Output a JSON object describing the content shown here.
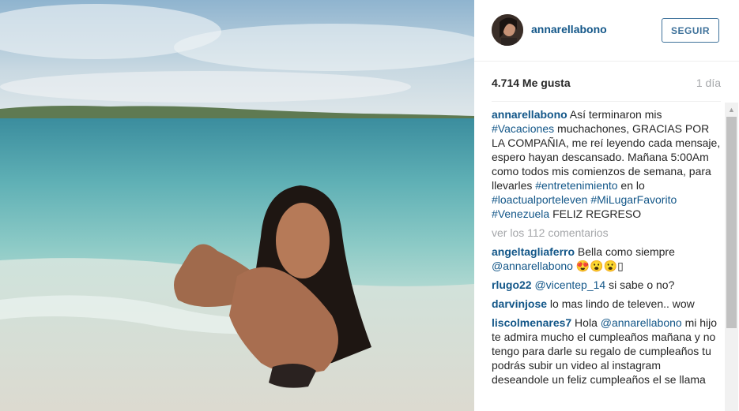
{
  "post": {
    "username": "annarellabono",
    "follow_label": "SEGUIR",
    "likes": "4.714 Me gusta",
    "time": "1 día"
  },
  "caption": {
    "user": "annarellabono",
    "t1": " Así terminaron mis ",
    "h1": "#Vacaciones",
    "t2": " muchachones, GRACIAS POR LA COMPAÑIA, me reí leyendo cada mensaje, espero hayan descansado. Mañana 5:00Am como todos mis comienzos de semana, para llevarles ",
    "h2": "#entretenimiento",
    "t3": " en lo ",
    "h3": "#loactualporteleven",
    "t4": " ",
    "h4": "#MiLugarFavorito",
    "t5": " ",
    "h5": "#Venezuela",
    "t6": " FELIZ REGRESO"
  },
  "more_comments": "ver los 112 comentarios",
  "comments": [
    {
      "user": "angeltagliaferro",
      "t1": " Bella como siempre ",
      "mention": "@annarellabono",
      "t2": " 😍😮😮▯"
    },
    {
      "user": "rlugo22",
      "mention": "@vicentep_14",
      "t1": " si sabe o no?"
    },
    {
      "user": "darvinjose",
      "t1": " lo mas lindo de televen.. wow"
    },
    {
      "user": "liscolmenares7",
      "t1": " Hola ",
      "mention": "@annarellabono",
      "t2": " mi hijo te admira mucho el cumpleaños mañana y no tengo para darle su regalo de cumpleaños tu podrás subir un video al instagram deseandole un feliz cumpleaños el se llama"
    }
  ],
  "colors": {
    "link": "#125688",
    "button": "#3f729b",
    "muted": "#a5a7aa"
  }
}
